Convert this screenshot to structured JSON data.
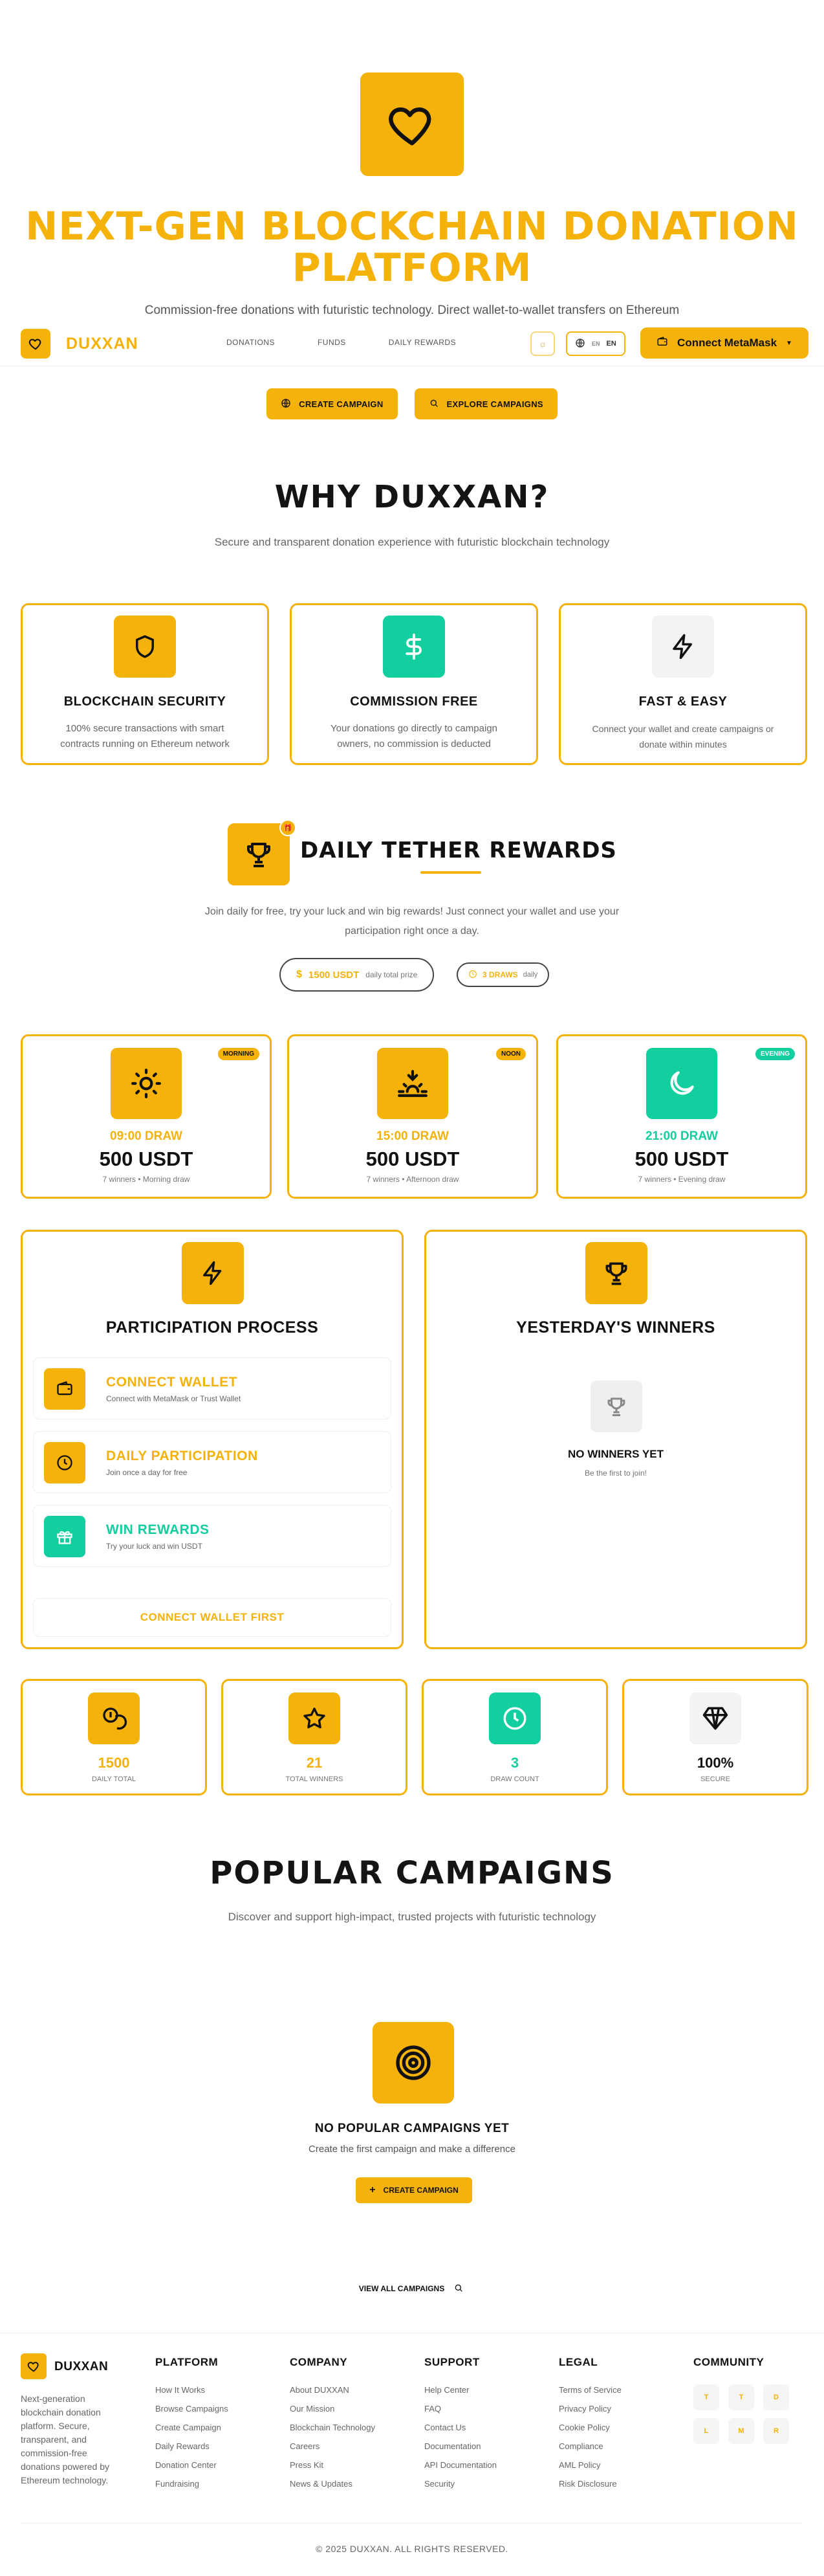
{
  "hero": {
    "title": "NEXT-GEN BLOCKCHAIN DONATION PLATFORM",
    "subtitle": "Commission-free donations with futuristic technology. Direct wallet-to-wallet transfers on Ethereum network.",
    "create_label": "CREATE CAMPAIGN",
    "explore_label": "EXPLORE CAMPAIGNS"
  },
  "nav": {
    "brand": "DUXXAN",
    "links": [
      "DONATIONS",
      "FUNDS",
      "DAILY REWARDS"
    ],
    "lang": "EN",
    "lang_code": "EN",
    "connect_label": "Connect MetaMask"
  },
  "why": {
    "title": "WHY DUXXAN?",
    "subtitle": "Secure and transparent donation experience with futuristic blockchain technology",
    "cards": [
      {
        "title": "BLOCKCHAIN SECURITY",
        "text": "100% secure transactions with smart contracts running on Ethereum network",
        "icon": "shield-icon"
      },
      {
        "title": "COMMISSION FREE",
        "text": "Your donations go directly to campaign owners, no commission is deducted",
        "icon": "dollar-icon"
      },
      {
        "title": "FAST & EASY",
        "text": "Connect your wallet and create campaigns or donate within minutes",
        "icon": "lightning-icon"
      }
    ]
  },
  "daily": {
    "title": "DAILY TETHER REWARDS",
    "subtitle": "Join daily for free, try your luck and win big rewards! Just connect your wallet and use your participation right once a day.",
    "prize_value": "1500 USDT",
    "prize_label": "daily total prize",
    "draws_value": "3 DRAWS",
    "draws_label": "daily",
    "draws": [
      {
        "tag": "MORNING",
        "time": "09:00 DRAW",
        "amount": "500 USDT",
        "note": "7 winners • Morning draw"
      },
      {
        "tag": "NOON",
        "time": "15:00 DRAW",
        "amount": "500 USDT",
        "note": "7 winners • Afternoon draw"
      },
      {
        "tag": "EVENING",
        "time": "21:00 DRAW",
        "amount": "500 USDT",
        "note": "7 winners • Evening draw"
      }
    ]
  },
  "participation": {
    "title": "PARTICIPATION PROCESS",
    "steps": [
      {
        "title": "CONNECT WALLET",
        "text": "Connect with MetaMask or Trust Wallet"
      },
      {
        "title": "DAILY PARTICIPATION",
        "text": "Join once a day for free"
      },
      {
        "title": "WIN REWARDS",
        "text": "Try your luck and win USDT"
      }
    ],
    "connect_first": "CONNECT WALLET FIRST"
  },
  "winners": {
    "title": "YESTERDAY'S WINNERS",
    "empty_title": "NO WINNERS YET",
    "empty_sub": "Be the first to join!"
  },
  "stats": [
    {
      "value": "1500",
      "label": "DAILY TOTAL"
    },
    {
      "value": "21",
      "label": "TOTAL WINNERS"
    },
    {
      "value": "3",
      "label": "DRAW COUNT"
    },
    {
      "value": "100%",
      "label": "SECURE"
    }
  ],
  "campaigns": {
    "title": "POPULAR CAMPAIGNS",
    "subtitle": "Discover and support high-impact, trusted projects with futuristic technology",
    "empty_title": "NO POPULAR CAMPAIGNS YET",
    "empty_sub": "Create the first campaign and make a difference",
    "create_label": "CREATE CAMPAIGN",
    "view_all": "VIEW ALL CAMPAIGNS"
  },
  "footer": {
    "brand": "DUXXAN",
    "description": "Next-generation blockchain donation platform. Secure, transparent, and commission-free donations powered by Ethereum technology.",
    "columns": [
      {
        "title": "PLATFORM",
        "links": [
          "How It Works",
          "Browse Campaigns",
          "Create Campaign",
          "Daily Rewards",
          "Donation Center",
          "Fundraising"
        ]
      },
      {
        "title": "COMPANY",
        "links": [
          "About DUXXAN",
          "Our Mission",
          "Blockchain Technology",
          "Careers",
          "Press Kit",
          "News & Updates"
        ]
      },
      {
        "title": "SUPPORT",
        "links": [
          "Help Center",
          "FAQ",
          "Contact Us",
          "Documentation",
          "API Documentation",
          "Security"
        ]
      },
      {
        "title": "LEGAL",
        "links": [
          "Terms of Service",
          "Privacy Policy",
          "Cookie Policy",
          "Compliance",
          "AML Policy",
          "Risk Disclosure"
        ]
      }
    ],
    "community_title": "COMMUNITY",
    "social": [
      "T",
      "T",
      "D",
      "L",
      "M",
      "R"
    ],
    "copyright": "© 2025 DUXXAN. ALL RIGHTS RESERVED."
  },
  "colors": {
    "gold": "#F4B20A",
    "teal": "#13CE9E",
    "dark": "#141414"
  }
}
